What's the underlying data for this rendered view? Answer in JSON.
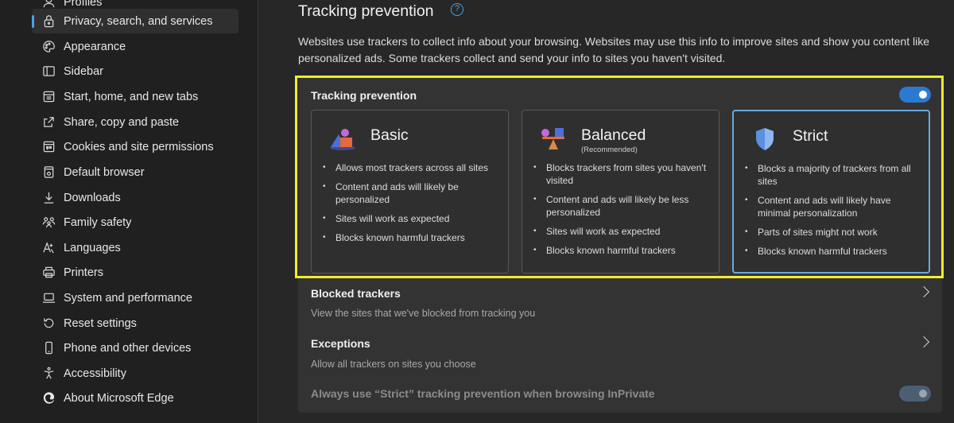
{
  "sidebar": {
    "items": [
      {
        "label": "Profiles",
        "icon": "profile-icon"
      },
      {
        "label": "Privacy, search, and services",
        "icon": "lock-icon",
        "active": true
      },
      {
        "label": "Appearance",
        "icon": "palette-icon"
      },
      {
        "label": "Sidebar",
        "icon": "sidebar-icon"
      },
      {
        "label": "Start, home, and new tabs",
        "icon": "home-tabs-icon"
      },
      {
        "label": "Share, copy and paste",
        "icon": "share-icon"
      },
      {
        "label": "Cookies and site permissions",
        "icon": "cookies-icon"
      },
      {
        "label": "Default browser",
        "icon": "browser-icon"
      },
      {
        "label": "Downloads",
        "icon": "download-icon"
      },
      {
        "label": "Family safety",
        "icon": "family-icon"
      },
      {
        "label": "Languages",
        "icon": "language-icon"
      },
      {
        "label": "Printers",
        "icon": "printer-icon"
      },
      {
        "label": "System and performance",
        "icon": "laptop-icon"
      },
      {
        "label": "Reset settings",
        "icon": "reset-icon"
      },
      {
        "label": "Phone and other devices",
        "icon": "phone-icon"
      },
      {
        "label": "Accessibility",
        "icon": "accessibility-icon"
      },
      {
        "label": "About Microsoft Edge",
        "icon": "edge-logo-icon"
      }
    ]
  },
  "main": {
    "title": "Tracking prevention",
    "help_glyph": "?",
    "description": "Websites use trackers to collect info about your browsing. Websites may use this info to improve sites and show you content like personalized ads. Some trackers collect and send your info to sites you haven't visited.",
    "tracking_toggle_label": "Tracking prevention",
    "tracking_toggle_on": true,
    "cards": [
      {
        "title": "Basic",
        "subtitle": "",
        "icon": "basic-shapes-icon",
        "bullets": [
          "Allows most trackers across all sites",
          "Content and ads will likely be personalized",
          "Sites will work as expected",
          "Blocks known harmful trackers"
        ]
      },
      {
        "title": "Balanced",
        "subtitle": "(Recommended)",
        "icon": "balance-scale-icon",
        "bullets": [
          "Blocks trackers from sites you haven't visited",
          "Content and ads will likely be less personalized",
          "Sites will work as expected",
          "Blocks known harmful trackers"
        ]
      },
      {
        "title": "Strict",
        "subtitle": "",
        "icon": "shield-icon",
        "selected": true,
        "bullets": [
          "Blocks a majority of trackers from all sites",
          "Content and ads will likely have minimal personalization",
          "Parts of sites might not work",
          "Blocks known harmful trackers"
        ]
      }
    ],
    "blocked_trackers": {
      "title": "Blocked trackers",
      "description": "View the sites that we've blocked from tracking you"
    },
    "exceptions": {
      "title": "Exceptions",
      "description": "Allow all trackers on sites you choose"
    },
    "inprivate": {
      "label": "Always use “Strict” tracking prevention when browsing InPrivate",
      "enabled": false
    }
  },
  "colors": {
    "accent": "#2a7ad2",
    "highlight_border": "#f2ec2b",
    "selected_card_border": "#6aa8dc"
  }
}
